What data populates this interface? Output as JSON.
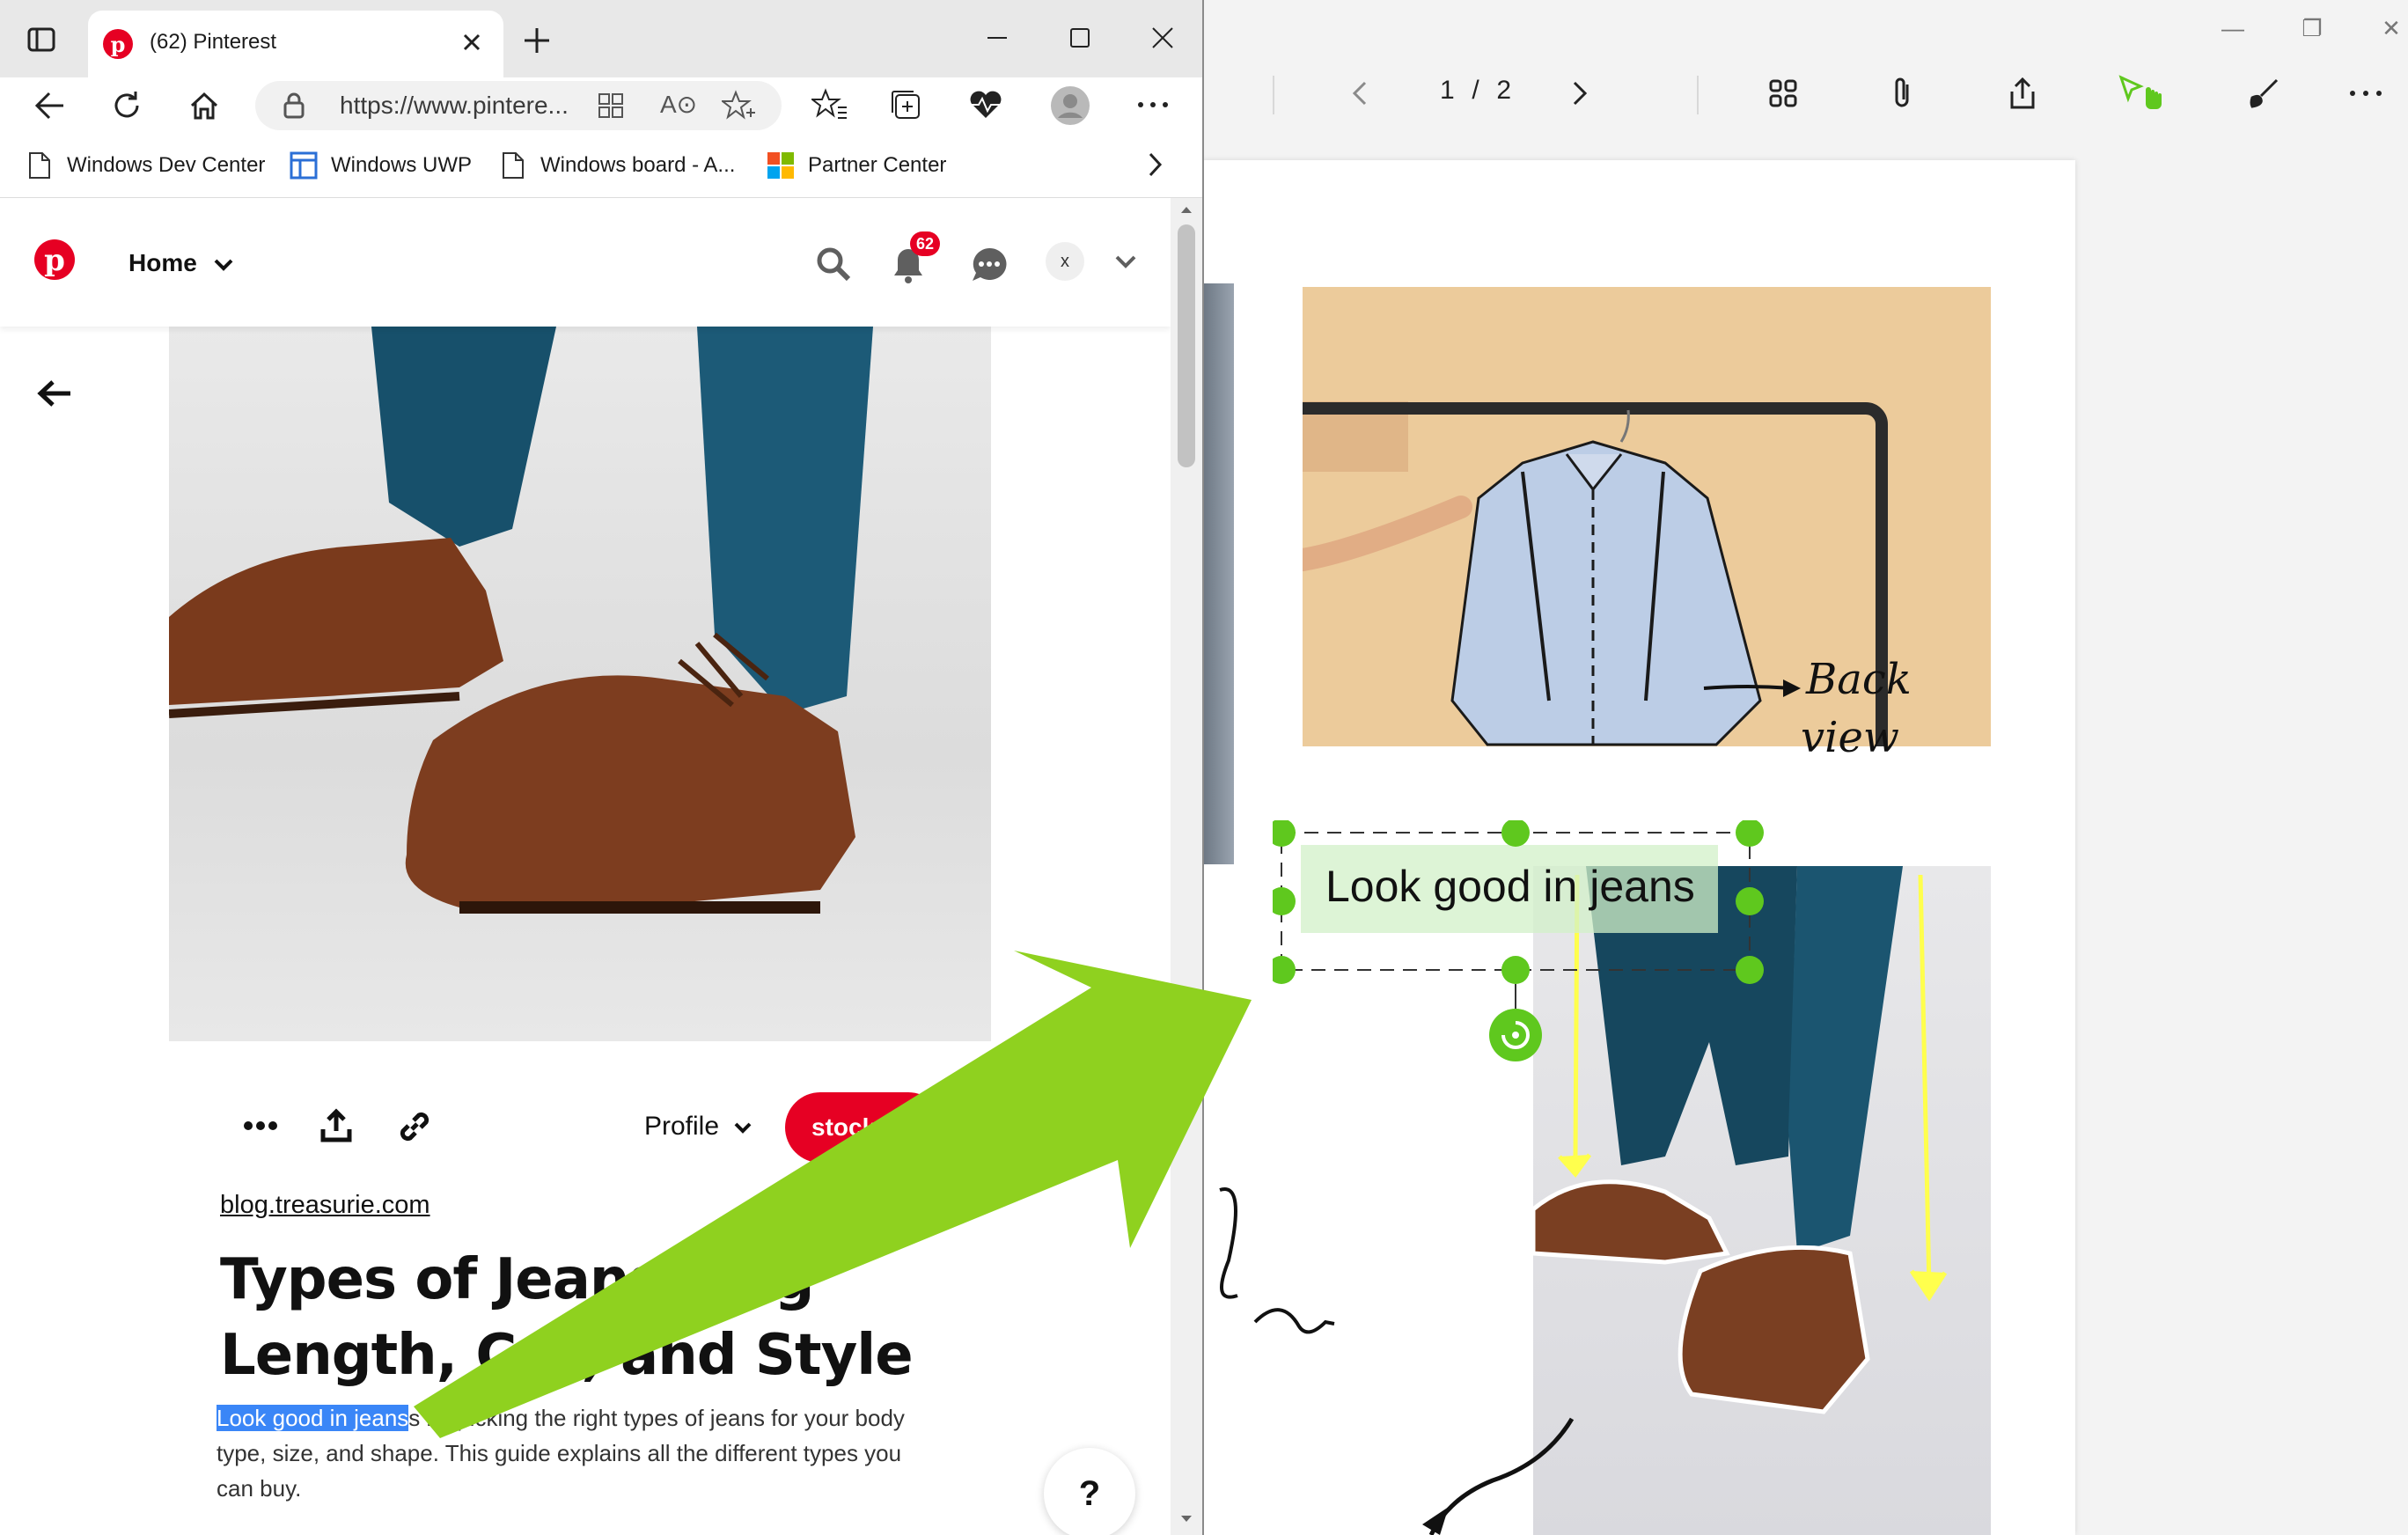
{
  "browser": {
    "tab_title": "(62) Pinterest",
    "url": "https://www.pintere...",
    "favorites": [
      {
        "label": "Windows Dev Center",
        "icon": "page-icon"
      },
      {
        "label": "Windows UWP",
        "icon": "uwp-icon"
      },
      {
        "label": "Windows board - A...",
        "icon": "page-icon"
      },
      {
        "label": "Partner Center",
        "icon": "microsoft-logo-icon"
      }
    ]
  },
  "pinterest": {
    "nav_home": "Home",
    "notification_count": "62",
    "avatar_initial": "x",
    "profile_label": "Profile",
    "save_button": "stock",
    "source_link": "blog.treasurie.com",
    "title": "Types of Jeans: Leg Length, Cut, and Style",
    "desc_highlight": "Look good in jeans",
    "desc_rest": "s by picking the right types of jeans for your body type, size, and shape. This guide explains all the different types you can buy.",
    "help": "?",
    "brand_color": "#e60023",
    "highlight_color": "#3a86f7"
  },
  "viewer": {
    "page_current": "1",
    "page_separator": "/",
    "page_total": "2",
    "ink_text": "Look good in jeans",
    "handwritten_note": "Back view",
    "accent": "#5fc81e",
    "arrow_color": "#8fd11f",
    "ink_highlight": "#ffff4d"
  }
}
